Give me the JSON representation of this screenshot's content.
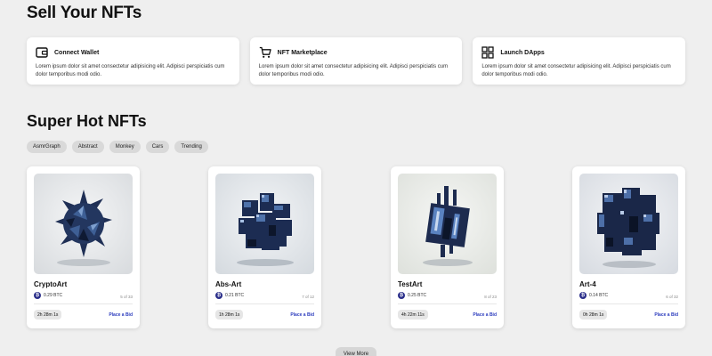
{
  "sell_section": {
    "title": "Sell Your NFTs",
    "features": [
      {
        "icon": "wallet-icon",
        "title": "Connect Wallet",
        "desc": "Lorem ipsum dolor sit amet consectetur adipisicing elit. Adipisci perspiciatis cum dolor temporibus modi odio."
      },
      {
        "icon": "cart-icon",
        "title": "NFT Marketplace",
        "desc": "Lorem ipsum dolor sit amet consectetur adipisicing elit. Adipisci perspiciatis cum dolor temporibus modi odio."
      },
      {
        "icon": "grid-apps-icon",
        "title": "Launch DApps",
        "desc": "Lorem ipsum dolor sit amet consectetur adipisicing elit. Adipisci perspiciatis cum dolor temporibus modi odio."
      }
    ]
  },
  "hot_section": {
    "title": "Super Hot NFTs",
    "tags": [
      "AsmrGraph",
      "Abstract",
      "Monkey",
      "Cars",
      "Trending"
    ],
    "cards": [
      {
        "name": "CryptoArt",
        "price": "0.29 BTC",
        "edition": "5 of 33",
        "timer": "2h 28m 1s",
        "bid_label": "Place a Bid"
      },
      {
        "name": "Abs-Art",
        "price": "0.21 BTC",
        "edition": "7 of 12",
        "timer": "1h 28m 1s",
        "bid_label": "Place a Bid"
      },
      {
        "name": "TestArt",
        "price": "0.25 BTC",
        "edition": "8 of 23",
        "timer": "4h 22m 11s",
        "bid_label": "Place a Bid"
      },
      {
        "name": "Art-4",
        "price": "0.14 BTC",
        "edition": "6 of 32",
        "timer": "0h 28m 1s",
        "bid_label": "Place a Bid"
      }
    ],
    "view_more_label": "View More"
  },
  "colors": {
    "background": "#efefef",
    "accent": "#2b3bbd",
    "btc_badge": "#2b2f8a",
    "tag_bg": "#d9d9d9"
  }
}
